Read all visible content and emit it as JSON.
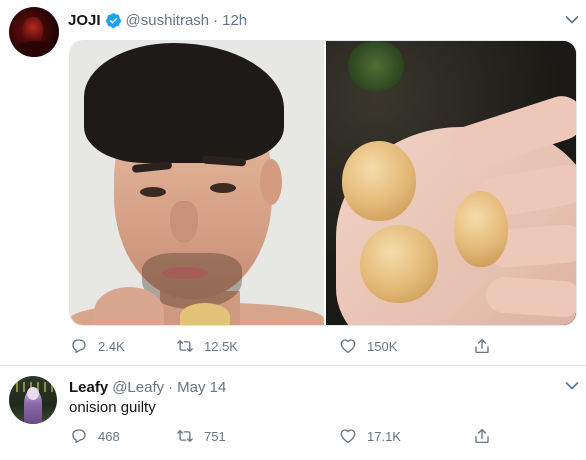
{
  "tweets": [
    {
      "author": {
        "name": "JOJI",
        "handle": "@sushitrash",
        "verified": true
      },
      "separator": "·",
      "time": "12h",
      "media": [
        {
          "description": "man-holding-onion-peel-photo"
        },
        {
          "description": "hand-holding-three-onions-photo"
        }
      ],
      "stats": {
        "replies": "2.4K",
        "retweets": "12.5K",
        "likes": "150K"
      }
    },
    {
      "author": {
        "name": "Leafy",
        "handle": "@Leafy",
        "verified": false
      },
      "separator": "·",
      "time": "May 14",
      "text": "onision guilty",
      "stats": {
        "replies": "468",
        "retweets": "751",
        "likes": "17.1K"
      }
    }
  ],
  "icons": {
    "verified": "verified-badge-icon",
    "caret": "chevron-down-icon",
    "reply": "reply-icon",
    "retweet": "retweet-icon",
    "like": "heart-icon",
    "share": "share-icon"
  },
  "colors": {
    "verified_blue": "#1da1f2",
    "secondary_text": "#657786",
    "primary_text": "#14171a",
    "divider": "#e6ecf0"
  }
}
